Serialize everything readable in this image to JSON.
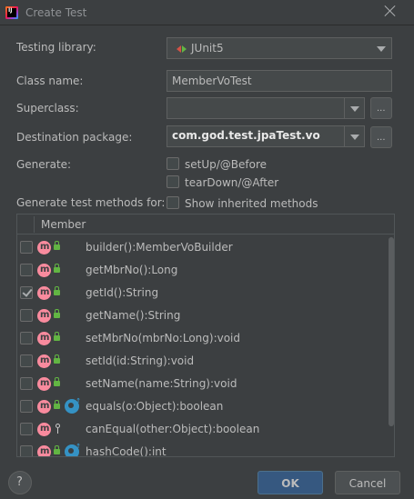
{
  "window": {
    "title": "Create Test",
    "app_icon": "intellij-icon",
    "close_icon": "close-icon"
  },
  "form": {
    "testing_library": {
      "label": "Testing library:",
      "value": "JUnit5",
      "icon": "junit-icon"
    },
    "class_name": {
      "label": "Class name:",
      "value": "MemberVoTest"
    },
    "superclass": {
      "label": "Superclass:",
      "value": "",
      "browse_label": "..."
    },
    "destination_package": {
      "label": "Destination package:",
      "value": "com.god.test.jpaTest.vo",
      "browse_label": "..."
    },
    "generate": {
      "label": "Generate:",
      "options": [
        {
          "label": "setUp/@Before",
          "checked": false
        },
        {
          "label": "tearDown/@After",
          "checked": false
        }
      ]
    },
    "generate_methods": {
      "label": "Generate test methods for:",
      "show_inherited_label": "Show inherited methods",
      "show_inherited_checked": false
    }
  },
  "members_table": {
    "header": "Member",
    "rows": [
      {
        "method": "builder():MemberVoBuilder",
        "checked": false,
        "icons": [
          "method-icon",
          "public-lock-icon"
        ]
      },
      {
        "method": "getMbrNo():Long",
        "checked": false,
        "icons": [
          "method-icon",
          "public-lock-icon"
        ]
      },
      {
        "method": "getId():String",
        "checked": true,
        "icons": [
          "method-icon",
          "public-lock-icon"
        ]
      },
      {
        "method": "getName():String",
        "checked": false,
        "icons": [
          "method-icon",
          "public-lock-icon"
        ]
      },
      {
        "method": "setMbrNo(mbrNo:Long):void",
        "checked": false,
        "icons": [
          "method-icon",
          "public-lock-icon"
        ]
      },
      {
        "method": "setId(id:String):void",
        "checked": false,
        "icons": [
          "method-icon",
          "public-lock-icon"
        ]
      },
      {
        "method": "setName(name:String):void",
        "checked": false,
        "icons": [
          "method-icon",
          "public-lock-icon"
        ]
      },
      {
        "method": "equals(o:Object):boolean",
        "checked": false,
        "icons": [
          "method-icon",
          "public-lock-icon",
          "override-icon"
        ]
      },
      {
        "method": "canEqual(other:Object):boolean",
        "checked": false,
        "icons": [
          "method-icon",
          "protected-key-icon"
        ]
      },
      {
        "method": "hashCode():int",
        "checked": false,
        "icons": [
          "method-icon",
          "public-lock-icon",
          "override-icon"
        ]
      }
    ]
  },
  "footer": {
    "help_label": "?",
    "ok_label": "OK",
    "cancel_label": "Cancel"
  },
  "colors": {
    "background": "#3c3f41",
    "field": "#45494a",
    "text": "#bbbbbb",
    "primary_button": "#365880",
    "method_icon": "#f98b9e",
    "lock_icon": "#62b543",
    "override_icon": "#3592c4"
  }
}
